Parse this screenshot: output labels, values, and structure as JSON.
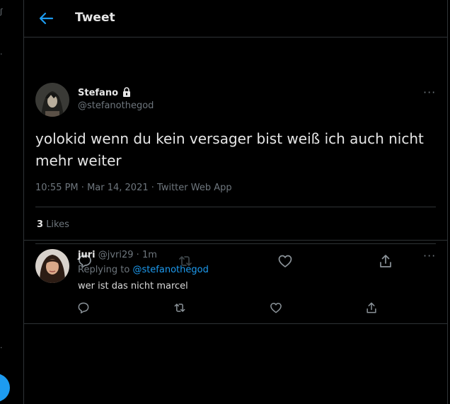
{
  "header": {
    "title": "Tweet",
    "back_icon": "arrow-left-icon",
    "accent": "#1d9bf0"
  },
  "tweet": {
    "author_name": "Stefano",
    "author_handle": "@stefanothegod",
    "locked_icon": "lock-icon",
    "text": "yolokid wenn du kein versager bist weiß ich auch nicht mehr weiter",
    "time": "10:55 PM",
    "date": "Mar 14, 2021",
    "source": "Twitter Web App",
    "like_count": "3",
    "likes_label": "Likes"
  },
  "reply": {
    "author_name": "juri",
    "author_handle": "@jvri29",
    "age": "1m",
    "replying_label": "Replying to",
    "replying_to": "@stefanothegod",
    "text": "wer ist das nicht marcel"
  },
  "icons": {
    "reply": "reply-icon",
    "retweet": "retweet-icon",
    "like": "heart-icon",
    "share": "share-icon",
    "more": "more-icon"
  }
}
